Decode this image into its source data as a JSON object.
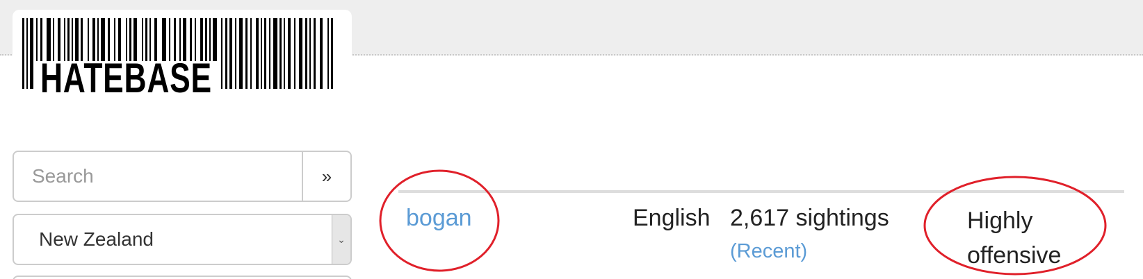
{
  "logo": {
    "text": "HATEBASE"
  },
  "search": {
    "placeholder": "Search",
    "button_label": "»"
  },
  "country_filter": {
    "selected": "New Zealand",
    "arrow": "⌄"
  },
  "result": {
    "term": "bogan",
    "language": "English",
    "sightings": "2,617 sightings",
    "recent_label": "(Recent)",
    "offensiveness": "Highly offensive"
  },
  "colors": {
    "link": "#5b9bd5",
    "annotation": "#e0202a",
    "top_band": "#eeeeee"
  }
}
